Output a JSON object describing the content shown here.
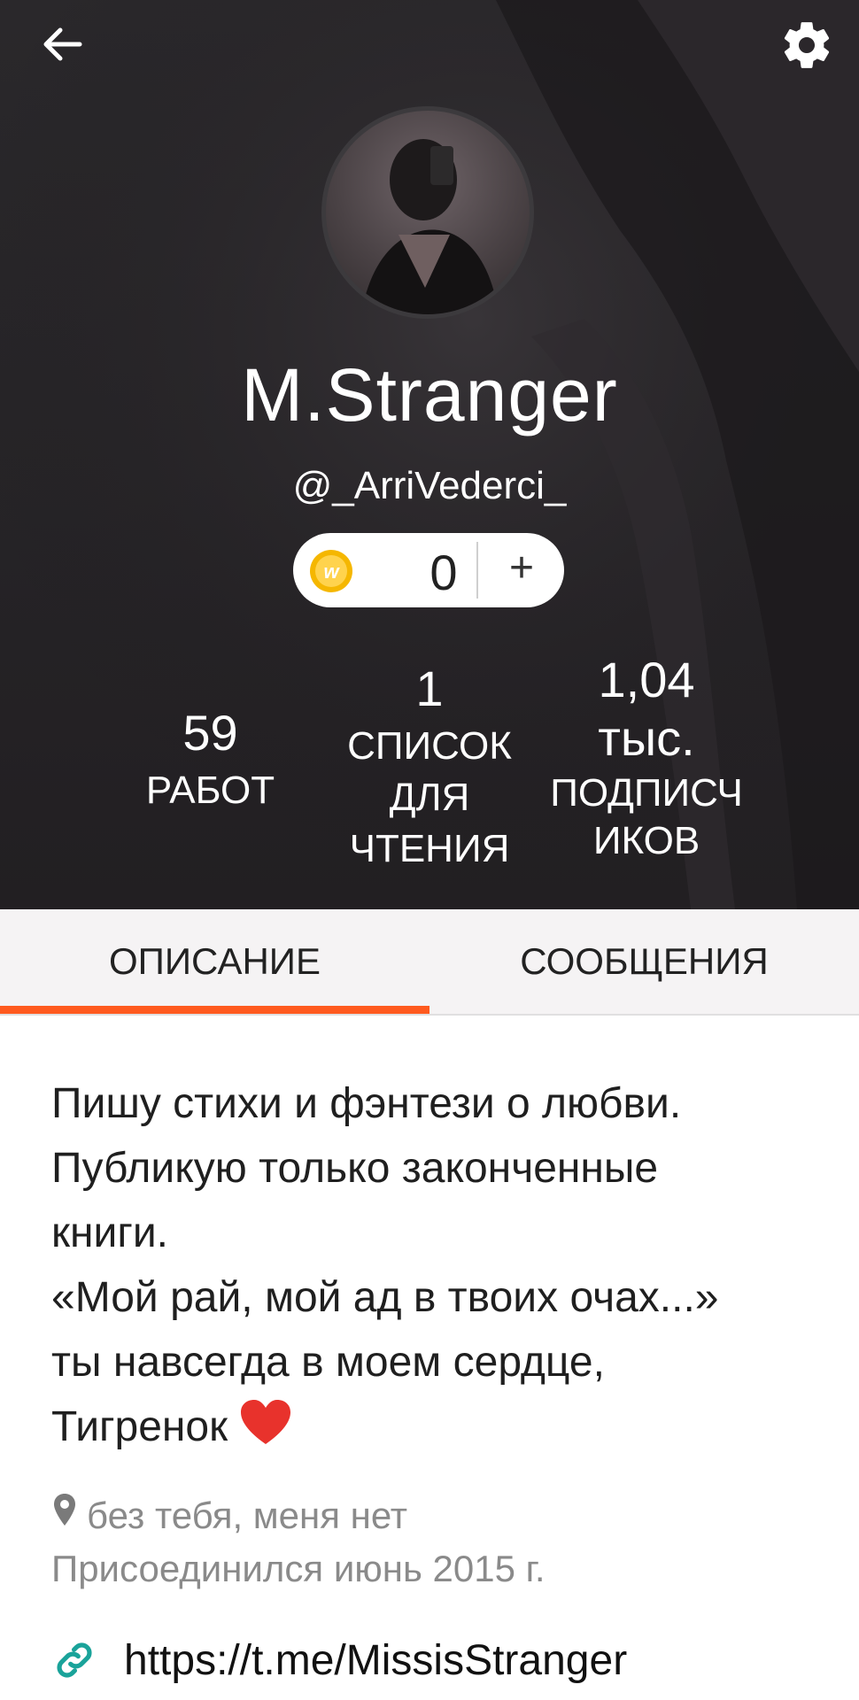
{
  "header": {
    "back_icon": "arrow-left-icon",
    "settings_icon": "gear-icon"
  },
  "profile": {
    "display_name": "M.Stranger",
    "username": "@_ArriVederci_",
    "coins": {
      "count": "0",
      "add_label": "+",
      "coin_icon": "wattpad-coin-icon"
    }
  },
  "stats": {
    "works": {
      "value": "59",
      "label": "РАБОТ"
    },
    "reading_lists": {
      "value": "1",
      "label_line1": "СПИСОК",
      "label_line2": "ДЛЯ",
      "label_line3": "ЧТЕНИЯ"
    },
    "followers": {
      "value_line1": "1,04",
      "value_line2": "тыс.",
      "label_line1": "ПОДПИСЧ",
      "label_line2": "ИКОВ"
    }
  },
  "tabs": [
    {
      "label": "ОПИСАНИЕ",
      "active": true
    },
    {
      "label": "СООБЩЕНИЯ",
      "active": false
    }
  ],
  "bio": {
    "lines": [
      "Пишу стихи и фэнтези о любви.",
      "Публикую только законченные",
      "книги.",
      "«Мой рай, мой ад в твоих очах...»",
      "ты навсегда в моем сердце,",
      "Тигренок"
    ],
    "emoji": "heart-emoji"
  },
  "location": {
    "icon": "location-pin-icon",
    "text": "без тебя, меня нет"
  },
  "joined": "Присоединился июнь 2015 г.",
  "link": {
    "icon": "link-icon",
    "url": "https://t.me/MissisStranger"
  },
  "colors": {
    "accent": "#ff5a1f",
    "link_icon": "#1aa39a",
    "cover_bg": "#262427",
    "muted_text": "#8a8a8a"
  }
}
